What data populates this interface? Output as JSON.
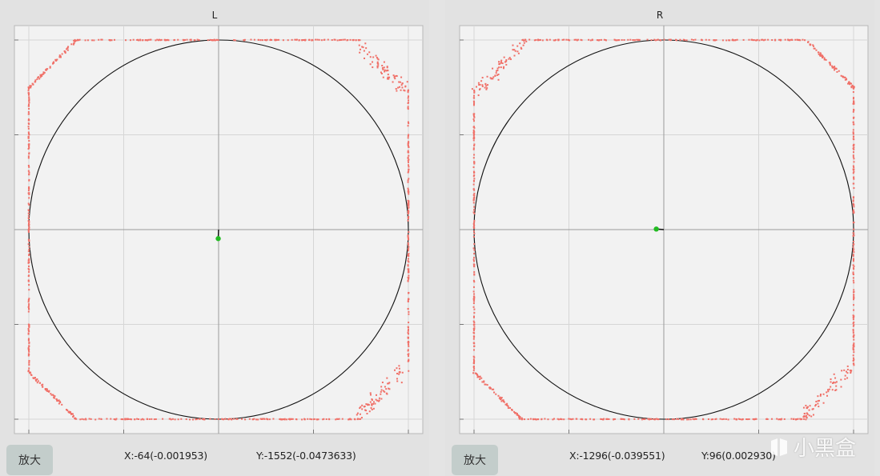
{
  "panels": [
    {
      "id": "left",
      "title": "L",
      "zoom_label": "放大",
      "x_readout": "X:-64(-0.001953)",
      "y_readout": "Y:-1552(-0.0473633)",
      "stick_position": {
        "x": -0.001953,
        "y": -0.0473633
      }
    },
    {
      "id": "right",
      "title": "R",
      "zoom_label": "放大",
      "x_readout": "X:-1296(-0.039551)",
      "y_readout": "Y:96(0.002930)",
      "stick_position": {
        "x": -0.039551,
        "y": 0.00293
      }
    }
  ],
  "colors": {
    "trace": "#f07068",
    "stick_dot": "#22bb22",
    "circle": "#111111",
    "plot_bg": "#f2f2f2",
    "grid": "#d6d6d6",
    "axis": "#9a9a9a"
  },
  "watermark": {
    "text": "小黑盒"
  }
}
